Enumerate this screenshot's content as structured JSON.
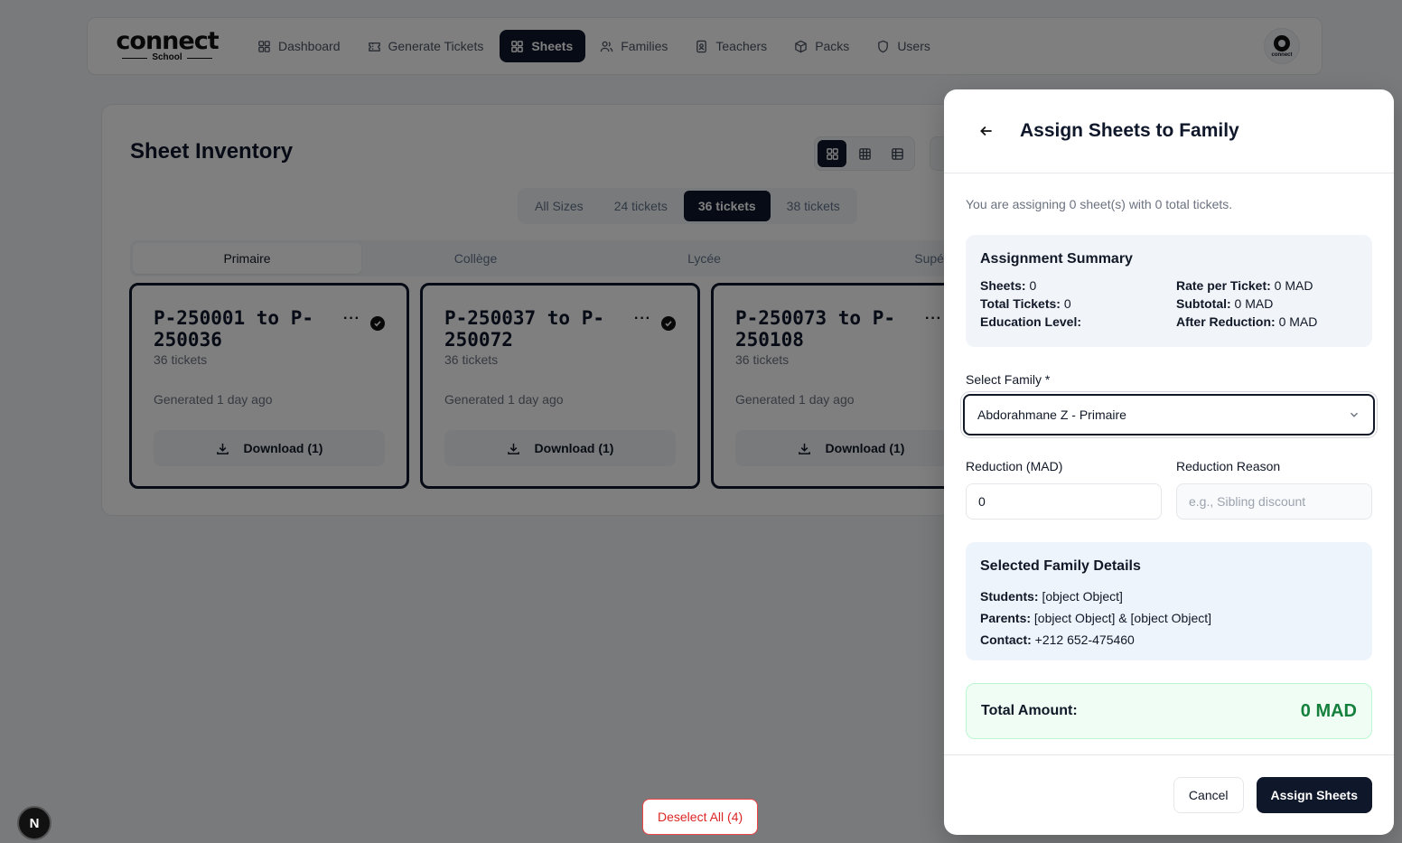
{
  "nav": {
    "logo_main": "connect",
    "logo_sub": "School",
    "items": [
      {
        "label": "Dashboard",
        "icon": "dashboard-icon"
      },
      {
        "label": "Generate Tickets",
        "icon": "ticket-icon"
      },
      {
        "label": "Sheets",
        "icon": "grid-icon",
        "active": true
      },
      {
        "label": "Families",
        "icon": "users-icon"
      },
      {
        "label": "Teachers",
        "icon": "badge-icon"
      },
      {
        "label": "Packs",
        "icon": "box-icon"
      },
      {
        "label": "Users",
        "icon": "shield-icon"
      }
    ],
    "avatar_text": "connect"
  },
  "inventory": {
    "title": "Sheet Inventory",
    "size_tabs": [
      "All Sizes",
      "24 tickets",
      "36 tickets",
      "38 tickets"
    ],
    "active_size": "36 tickets",
    "level_tabs": [
      "Primaire",
      "Collège",
      "Lycée",
      "Supéri"
    ],
    "active_level": "Primaire",
    "cards": [
      {
        "title": "P-250001 to P-250036",
        "count": "36 tickets",
        "generated": "Generated 1 day ago",
        "download": "Download (1)",
        "selected": true
      },
      {
        "title": "P-250037 to P-250072",
        "count": "36 tickets",
        "generated": "Generated 1 day ago",
        "download": "Download (1)",
        "selected": true
      },
      {
        "title": "P-250073 to P-250108",
        "count": "36 tickets",
        "generated": "Generated 1 day ago",
        "download": "Download (1)",
        "selected": false
      }
    ]
  },
  "panel": {
    "title": "Assign Sheets to Family",
    "description": "You are assigning 0 sheet(s) with 0 total tickets.",
    "summary": {
      "heading": "Assignment Summary",
      "sheets_label": "Sheets:",
      "sheets": "0",
      "total_tickets_label": "Total Tickets:",
      "total_tickets": "0",
      "education_label": "Education Level:",
      "education": "",
      "rate_label": "Rate per Ticket:",
      "rate": "0 MAD",
      "subtotal_label": "Subtotal:",
      "subtotal": "0 MAD",
      "after_label": "After Reduction:",
      "after": "0 MAD"
    },
    "select_family_label": "Select Family *",
    "select_family_value": "Abdorahmane Z - Primaire",
    "reduction_label": "Reduction (MAD)",
    "reduction_value": "0",
    "reason_label": "Reduction Reason",
    "reason_placeholder": "e.g., Sibling discount",
    "family_details": {
      "heading": "Selected Family Details",
      "students_label": "Students:",
      "students": "[object Object]",
      "parents_label": "Parents:",
      "parents": "[object Object] & [object Object]",
      "contact_label": "Contact:",
      "contact": "+212 652-475460"
    },
    "total_label": "Total Amount:",
    "total_value": "0 MAD",
    "cancel": "Cancel",
    "submit": "Assign Sheets"
  },
  "deselect_all": "Deselect All (4)",
  "dev_badge": "N",
  "colors": {
    "primary": "#0f172a",
    "success": "#15803d",
    "danger": "#dc2626"
  }
}
